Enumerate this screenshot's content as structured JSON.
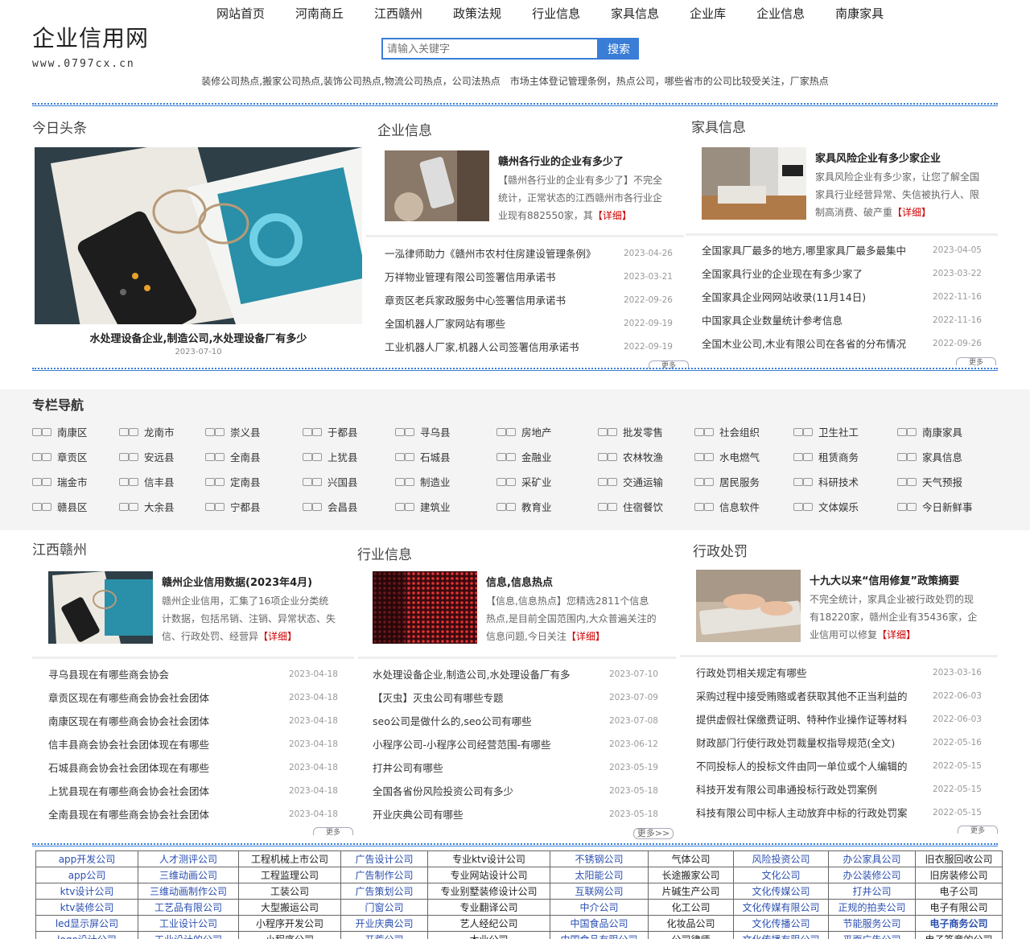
{
  "site": {
    "name": "企业信用网",
    "url": "www.0797cx.cn"
  },
  "nav": [
    "网站首页",
    "河南商丘",
    "江西赣州",
    "政策法规",
    "行业信息",
    "家具信息",
    "企业库",
    "企业信息",
    "南康家具"
  ],
  "search": {
    "placeholder": "请输入关键字",
    "button": "搜索"
  },
  "hot": "装修公司热点,搬家公司热点,装饰公司热点,物流公司热点，公司法热点　市场主体登记管理条例，热点公司，哪些省市的公司比较受关注，厂家热点",
  "today": {
    "title": "今日头条",
    "caption": "水处理设备企业,制造公司,水处理设备厂有多少",
    "date": "2023-07-10"
  },
  "company": {
    "title": "企业信息",
    "feature_title": "赣州各行业的企业有多少了",
    "feature_desc": "【赣州各行业的企业有多少了】不完全统计，正常状态的江西赣州市各行业企业现有882550家，其",
    "detail": "【详细】",
    "items": [
      {
        "t": "一泓律师助力《赣州市农村住房建设管理条例》",
        "d": "2023-04-26"
      },
      {
        "t": "万祥物业管理有限公司签署信用承诺书",
        "d": "2023-03-21"
      },
      {
        "t": "章贡区老兵家政服务中心签署信用承诺书",
        "d": "2022-09-26"
      },
      {
        "t": "全国机器人厂家网站有哪些",
        "d": "2022-09-19"
      },
      {
        "t": "工业机器人厂家,机器人公司签署信用承诺书",
        "d": "2022-09-19"
      }
    ],
    "more": "更多"
  },
  "furniture": {
    "title": "家具信息",
    "feature_title": "家具风险企业有多少家企业",
    "feature_desc": "家具风险企业有多少家，让您了解全国家具行业经营异常、失信被执行人、限制高消费、破产重",
    "detail": "【详细】",
    "items": [
      {
        "t": "全国家具厂最多的地方,哪里家具厂最多最集中",
        "d": "2023-04-05"
      },
      {
        "t": "全国家具行业的企业现在有多少家了",
        "d": "2023-03-22"
      },
      {
        "t": "全国家具企业网网站收录(11月14日)",
        "d": "2022-11-16"
      },
      {
        "t": "中国家具企业数量统计参考信息",
        "d": "2022-11-16"
      },
      {
        "t": "全国木业公司,木业有限公司在各省的分布情况",
        "d": "2022-09-26"
      }
    ],
    "more": "更多"
  },
  "columns": {
    "title": "专栏导航",
    "rows": [
      [
        "南康区",
        "龙南市",
        "崇义县",
        "于都县",
        "寻乌县",
        "房地产",
        "批发零售",
        "社会组织",
        "卫生社工",
        "南康家具"
      ],
      [
        "章贡区",
        "安远县",
        "全南县",
        "上犹县",
        "石城县",
        "金融业",
        "农林牧渔",
        "水电燃气",
        "租赁商务",
        "家具信息"
      ],
      [
        "瑞金市",
        "信丰县",
        "定南县",
        "兴国县",
        "制造业",
        "采矿业",
        "交通运输",
        "居民服务",
        "科研技术",
        "天气预报"
      ],
      [
        "赣县区",
        "大余县",
        "宁都县",
        "会昌县",
        "建筑业",
        "教育业",
        "住宿餐饮",
        "信息软件",
        "文体娱乐",
        "今日新鲜事"
      ]
    ]
  },
  "ganzhou": {
    "title": "江西赣州",
    "feature_title": "赣州企业信用数据(2023年4月)",
    "feature_desc": "赣州企业信用，汇集了16项企业分类统计数据，包括吊销、注销、异常状态、失信、行政处罚、经营异",
    "detail": "【详细】",
    "items": [
      {
        "t": "寻乌县现在有哪些商会协会",
        "d": "2023-04-18"
      },
      {
        "t": "章贡区现在有哪些商会协会社会团体",
        "d": "2023-04-18"
      },
      {
        "t": "南康区现在有哪些商会协会社会团体",
        "d": "2023-04-18"
      },
      {
        "t": "信丰县商会协会社会团体现在有哪些",
        "d": "2023-04-18"
      },
      {
        "t": "石城县商会协会社会团体现在有哪些",
        "d": "2023-04-18"
      },
      {
        "t": "上犹县现在有哪些商会协会社会团体",
        "d": "2023-04-18"
      },
      {
        "t": "全南县现在有哪些商会协会社会团体",
        "d": "2023-04-18"
      }
    ],
    "more": "更多"
  },
  "industry": {
    "title": "行业信息",
    "feature_title": "信息,信息热点",
    "feature_desc": "【信息,信息热点】您精选2811个信息热点,是目前全国范围内,大众普遍关注的信息问题,今日关注",
    "detail": "【详细】",
    "items": [
      {
        "t": "水处理设备企业,制造公司,水处理设备厂有多",
        "d": "2023-07-10"
      },
      {
        "t": "【灭虫】灭虫公司有哪些专题",
        "d": "2023-07-09"
      },
      {
        "t": "seo公司是做什么的,seo公司有哪些",
        "d": "2023-07-08"
      },
      {
        "t": "小程序公司-小程序公司经营范围-有哪些",
        "d": "2023-06-12"
      },
      {
        "t": "打井公司有哪些",
        "d": "2023-05-19"
      },
      {
        "t": "全国各省份风险投资公司有多少",
        "d": "2023-05-18"
      },
      {
        "t": "开业庆典公司有哪些",
        "d": "2023-05-18"
      }
    ],
    "more": "更多>>"
  },
  "penalty": {
    "title": "行政处罚",
    "feature_title": "十九大以来“信用修复”政策摘要",
    "feature_desc": "不完全统计，家具企业被行政处罚的现有18220家，赣州企业有35436家，企业信用可以修复",
    "detail": "【详细】",
    "items": [
      {
        "t": "行政处罚相关规定有哪些",
        "d": "2023-03-16"
      },
      {
        "t": "采购过程中接受贿赂或者获取其他不正当利益的",
        "d": "2022-06-03"
      },
      {
        "t": "提供虚假社保缴费证明、特种作业操作证等材料",
        "d": "2022-06-03"
      },
      {
        "t": "财政部门行使行政处罚裁量权指导规范(全文)",
        "d": "2022-05-16"
      },
      {
        "t": "不同投标人的投标文件由同一单位或个人编辑的",
        "d": "2022-05-15"
      },
      {
        "t": "科技开发有限公司串通投标行政处罚案例",
        "d": "2022-05-15"
      },
      {
        "t": "科技有限公司中标人主动放弃中标的行政处罚案",
        "d": "2022-05-15"
      }
    ],
    "more": "更多"
  },
  "tags": [
    [
      "app开发公司",
      "人才测评公司",
      "工程机械上市公司",
      "广告设计公司",
      "专业ktv设计公司",
      "不锈钢公司",
      "气体公司",
      "风险投资公司",
      "办公家具公司",
      "旧衣服回收公司"
    ],
    [
      "app公司",
      "三维动画公司",
      "工程监理公司",
      "广告制作公司",
      "专业网站设计公司",
      "太阳能公司",
      "长途搬家公司",
      "文化公司",
      "办公装修公司",
      "旧房装修公司"
    ],
    [
      "ktv设计公司",
      "三维动画制作公司",
      "工装公司",
      "广告策划公司",
      "专业别墅装修设计公司",
      "互联网公司",
      "片碱生产公司",
      "文化传媒公司",
      "打井公司",
      "电子公司"
    ],
    [
      "ktv装修公司",
      "工艺品有限公司",
      "大型搬运公司",
      "门窗公司",
      "专业翻译公司",
      "中介公司",
      "化工公司",
      "文化传媒有限公司",
      "正规的拍卖公司",
      "电子有限公司"
    ],
    [
      "led显示屏公司",
      "工业设计公司",
      "小程序开发公司",
      "开业庆典公司",
      "艺人经纪公司",
      "中国食品公司",
      "化妆品公司",
      "文化传播公司",
      "节能服务公司",
      "电子商务公司"
    ],
    [
      "logo设计公司",
      "工业设计的公司",
      "小程序公司",
      "开荒公司",
      "木业公司",
      "中国食品有限公司",
      "公司律师",
      "文化传播有限公司",
      "平面广告公司",
      "电子签章的公司"
    ]
  ],
  "colors": {
    "accent": "#3a7dd6",
    "detail": "#cc0000"
  }
}
